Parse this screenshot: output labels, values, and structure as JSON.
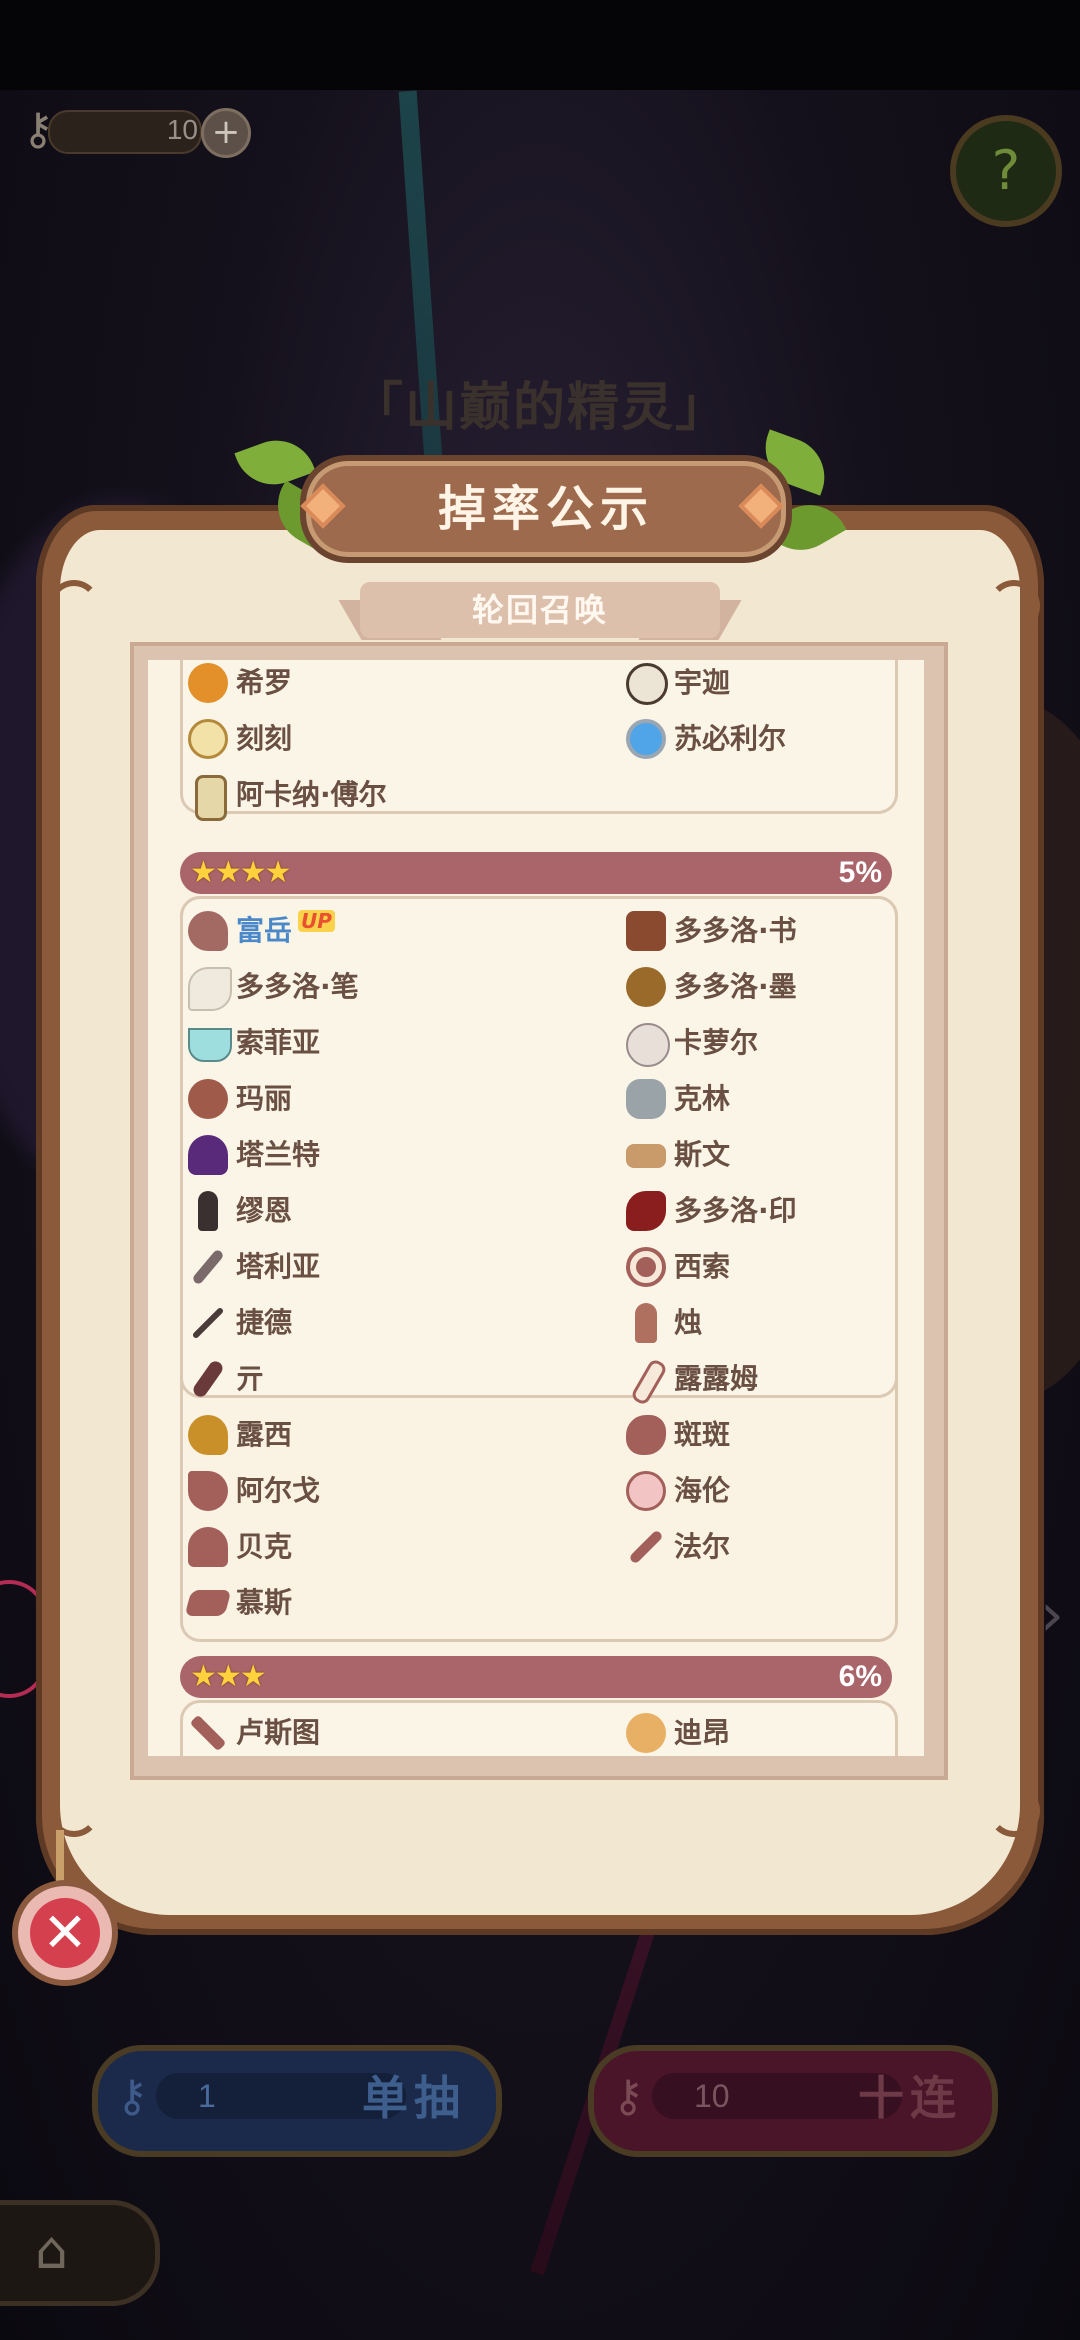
{
  "hud": {
    "key_count": "10",
    "plus": "+",
    "help": "?"
  },
  "banner_title": "「山巅的精灵」",
  "panel": {
    "title": "掉率公示",
    "subtitle": "轮回召唤"
  },
  "group_top": {
    "items": [
      {
        "name": "希罗"
      },
      {
        "name": "宇迦"
      },
      {
        "name": "刻刻"
      },
      {
        "name": "苏必利尔"
      },
      {
        "name": "阿卡纳·傅尔"
      }
    ]
  },
  "tier4": {
    "stars": "★★★★",
    "pct": "5%",
    "up_badge": "UP",
    "items": [
      {
        "name": "富岳"
      },
      {
        "name": "多多洛·书"
      },
      {
        "name": "多多洛·笔"
      },
      {
        "name": "多多洛·墨"
      },
      {
        "name": "索菲亚"
      },
      {
        "name": "卡萝尔"
      },
      {
        "name": "玛丽"
      },
      {
        "name": "克林"
      },
      {
        "name": "塔兰特"
      },
      {
        "name": "斯文"
      },
      {
        "name": "缪恩"
      },
      {
        "name": "多多洛·印"
      },
      {
        "name": "塔利亚"
      },
      {
        "name": "西索"
      },
      {
        "name": "捷德"
      },
      {
        "name": "烛"
      },
      {
        "name": "亓"
      },
      {
        "name": "露露姆"
      },
      {
        "name": "露西"
      },
      {
        "name": "斑斑"
      },
      {
        "name": "阿尔戈"
      },
      {
        "name": "海伦"
      },
      {
        "name": "贝克"
      },
      {
        "name": "法尔"
      },
      {
        "name": "慕斯"
      }
    ]
  },
  "tier3": {
    "stars": "★★★",
    "pct": "6%",
    "items": [
      {
        "name": "卢斯图"
      },
      {
        "name": "迪昂"
      }
    ]
  },
  "buttons": {
    "close": "✕",
    "single_count": "1",
    "single_label": "单抽",
    "ten_count": "10",
    "ten_label": "十连",
    "home": "⌂"
  },
  "colors": {
    "tier_bar": "#a9656a",
    "panel_bg": "#f2e7d0",
    "frame": "#8a5a3a",
    "up_highlight": "#4a88c9"
  }
}
